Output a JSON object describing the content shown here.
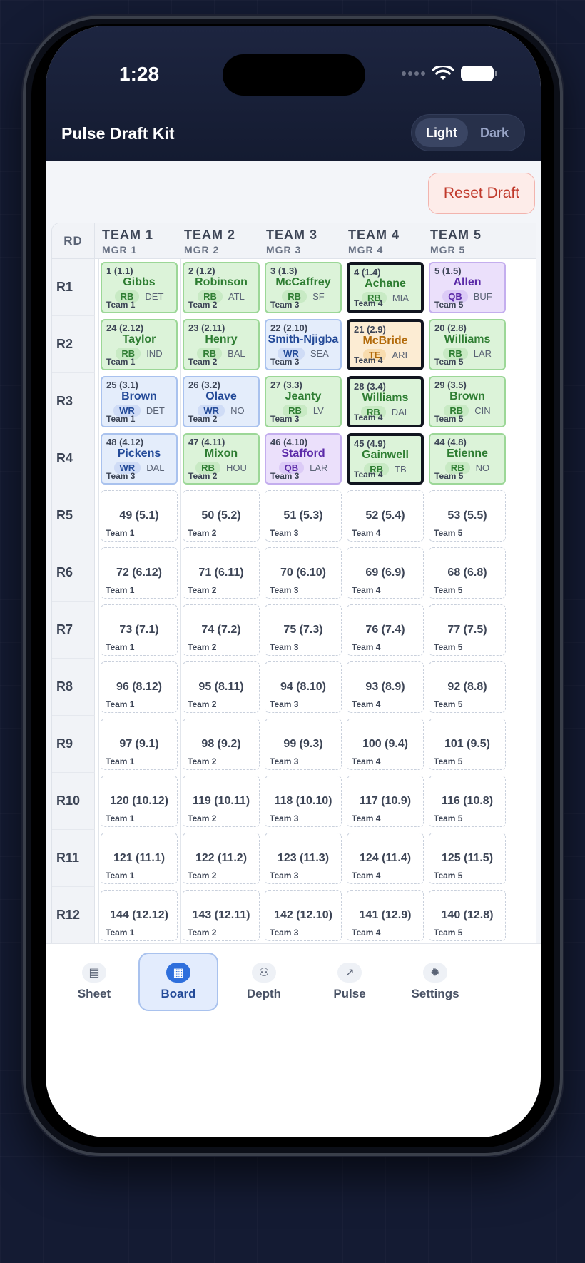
{
  "status": {
    "time": "1:28"
  },
  "header": {
    "title": "Pulse Draft Kit",
    "theme": {
      "light": "Light",
      "dark": "Dark",
      "selected": "Light"
    }
  },
  "actions": {
    "reset_label": "Reset Draft"
  },
  "board": {
    "rd_label": "RD",
    "teams": [
      {
        "name": "TEAM 1",
        "mgr": "MGR 1"
      },
      {
        "name": "TEAM 2",
        "mgr": "MGR 2"
      },
      {
        "name": "TEAM 3",
        "mgr": "MGR 3"
      },
      {
        "name": "TEAM 4",
        "mgr": "MGR 4"
      },
      {
        "name": "TEAM 5",
        "mgr": "MGR 5"
      }
    ],
    "rounds": [
      {
        "label": "R1",
        "cells": [
          {
            "pick": "1 (1.1)",
            "player": "Gibbs",
            "pos": "RB",
            "nfl": "DET",
            "team": "Team 1"
          },
          {
            "pick": "2 (1.2)",
            "player": "Robinson",
            "pos": "RB",
            "nfl": "ATL",
            "team": "Team 2"
          },
          {
            "pick": "3 (1.3)",
            "player": "McCaffrey",
            "pos": "RB",
            "nfl": "SF",
            "team": "Team 3"
          },
          {
            "pick": "4 (1.4)",
            "player": "Achane",
            "pos": "RB",
            "nfl": "MIA",
            "team": "Team 4",
            "mine": true
          },
          {
            "pick": "5 (1.5)",
            "player": "Allen",
            "pos": "QB",
            "nfl": "BUF",
            "team": "Team 5"
          }
        ]
      },
      {
        "label": "R2",
        "cells": [
          {
            "pick": "24 (2.12)",
            "player": "Taylor",
            "pos": "RB",
            "nfl": "IND",
            "team": "Team 1"
          },
          {
            "pick": "23 (2.11)",
            "player": "Henry",
            "pos": "RB",
            "nfl": "BAL",
            "team": "Team 2"
          },
          {
            "pick": "22 (2.10)",
            "player": "Smith-Njigba",
            "pos": "WR",
            "nfl": "SEA",
            "team": "Team 3"
          },
          {
            "pick": "21 (2.9)",
            "player": "McBride",
            "pos": "TE",
            "nfl": "ARI",
            "team": "Team 4",
            "mine": true
          },
          {
            "pick": "20 (2.8)",
            "player": "Williams",
            "pos": "RB",
            "nfl": "LAR",
            "team": "Team 5"
          }
        ]
      },
      {
        "label": "R3",
        "cells": [
          {
            "pick": "25 (3.1)",
            "player": "Brown",
            "pos": "WR",
            "nfl": "DET",
            "team": "Team 1"
          },
          {
            "pick": "26 (3.2)",
            "player": "Olave",
            "pos": "WR",
            "nfl": "NO",
            "team": "Team 2"
          },
          {
            "pick": "27 (3.3)",
            "player": "Jeanty",
            "pos": "RB",
            "nfl": "LV",
            "team": "Team 3"
          },
          {
            "pick": "28 (3.4)",
            "player": "Williams",
            "pos": "RB",
            "nfl": "DAL",
            "team": "Team 4",
            "mine": true
          },
          {
            "pick": "29 (3.5)",
            "player": "Brown",
            "pos": "RB",
            "nfl": "CIN",
            "team": "Team 5"
          }
        ]
      },
      {
        "label": "R4",
        "cells": [
          {
            "pick": "48 (4.12)",
            "player": "Pickens",
            "pos": "WR",
            "nfl": "DAL",
            "team": "Team 3"
          },
          {
            "pick": "47 (4.11)",
            "player": "Mixon",
            "pos": "RB",
            "nfl": "HOU",
            "team": "Team 2"
          },
          {
            "pick": "46 (4.10)",
            "player": "Stafford",
            "pos": "QB",
            "nfl": "LAR",
            "team": "Team 3"
          },
          {
            "pick": "45 (4.9)",
            "player": "Gainwell",
            "pos": "RB",
            "nfl": "TB",
            "team": "Team 4",
            "mine": true
          },
          {
            "pick": "44 (4.8)",
            "player": "Etienne",
            "pos": "RB",
            "nfl": "NO",
            "team": "Team 5"
          }
        ]
      },
      {
        "label": "R5",
        "cells": [
          {
            "pick": "49 (5.1)",
            "team": "Team 1"
          },
          {
            "pick": "50 (5.2)",
            "team": "Team 2"
          },
          {
            "pick": "51 (5.3)",
            "team": "Team 3"
          },
          {
            "pick": "52 (5.4)",
            "team": "Team 4"
          },
          {
            "pick": "53 (5.5)",
            "team": "Team 5"
          }
        ]
      },
      {
        "label": "R6",
        "cells": [
          {
            "pick": "72 (6.12)",
            "team": "Team 1"
          },
          {
            "pick": "71 (6.11)",
            "team": "Team 2"
          },
          {
            "pick": "70 (6.10)",
            "team": "Team 3"
          },
          {
            "pick": "69 (6.9)",
            "team": "Team 4"
          },
          {
            "pick": "68 (6.8)",
            "team": "Team 5"
          }
        ]
      },
      {
        "label": "R7",
        "cells": [
          {
            "pick": "73 (7.1)",
            "team": "Team 1"
          },
          {
            "pick": "74 (7.2)",
            "team": "Team 2"
          },
          {
            "pick": "75 (7.3)",
            "team": "Team 3"
          },
          {
            "pick": "76 (7.4)",
            "team": "Team 4"
          },
          {
            "pick": "77 (7.5)",
            "team": "Team 5"
          }
        ]
      },
      {
        "label": "R8",
        "cells": [
          {
            "pick": "96 (8.12)",
            "team": "Team 1"
          },
          {
            "pick": "95 (8.11)",
            "team": "Team 2"
          },
          {
            "pick": "94 (8.10)",
            "team": "Team 3"
          },
          {
            "pick": "93 (8.9)",
            "team": "Team 4"
          },
          {
            "pick": "92 (8.8)",
            "team": "Team 5"
          }
        ]
      },
      {
        "label": "R9",
        "cells": [
          {
            "pick": "97 (9.1)",
            "team": "Team 1"
          },
          {
            "pick": "98 (9.2)",
            "team": "Team 2"
          },
          {
            "pick": "99 (9.3)",
            "team": "Team 3"
          },
          {
            "pick": "100 (9.4)",
            "team": "Team 4"
          },
          {
            "pick": "101 (9.5)",
            "team": "Team 5"
          }
        ]
      },
      {
        "label": "R10",
        "cells": [
          {
            "pick": "120 (10.12)",
            "team": "Team 1"
          },
          {
            "pick": "119 (10.11)",
            "team": "Team 2"
          },
          {
            "pick": "118 (10.10)",
            "team": "Team 3"
          },
          {
            "pick": "117 (10.9)",
            "team": "Team 4"
          },
          {
            "pick": "116 (10.8)",
            "team": "Team 5"
          }
        ]
      },
      {
        "label": "R11",
        "cells": [
          {
            "pick": "121 (11.1)",
            "team": "Team 1"
          },
          {
            "pick": "122 (11.2)",
            "team": "Team 2"
          },
          {
            "pick": "123 (11.3)",
            "team": "Team 3"
          },
          {
            "pick": "124 (11.4)",
            "team": "Team 4"
          },
          {
            "pick": "125 (11.5)",
            "team": "Team 5"
          }
        ]
      },
      {
        "label": "R12",
        "cells": [
          {
            "pick": "144 (12.12)",
            "team": "Team 1"
          },
          {
            "pick": "143 (12.11)",
            "team": "Team 2"
          },
          {
            "pick": "142 (12.10)",
            "team": "Team 3"
          },
          {
            "pick": "141 (12.9)",
            "team": "Team 4"
          },
          {
            "pick": "140 (12.8)",
            "team": "Team 5"
          }
        ]
      }
    ]
  },
  "tabs": [
    {
      "label": "Sheet",
      "icon": "sheet-icon",
      "glyph": "▤"
    },
    {
      "label": "Board",
      "icon": "board-icon",
      "glyph": "▦",
      "active": true
    },
    {
      "label": "Depth",
      "icon": "depth-icon",
      "glyph": "⚇"
    },
    {
      "label": "Pulse",
      "icon": "pulse-icon",
      "glyph": "↗"
    },
    {
      "label": "Settings",
      "icon": "gear-icon",
      "glyph": "✹"
    }
  ]
}
